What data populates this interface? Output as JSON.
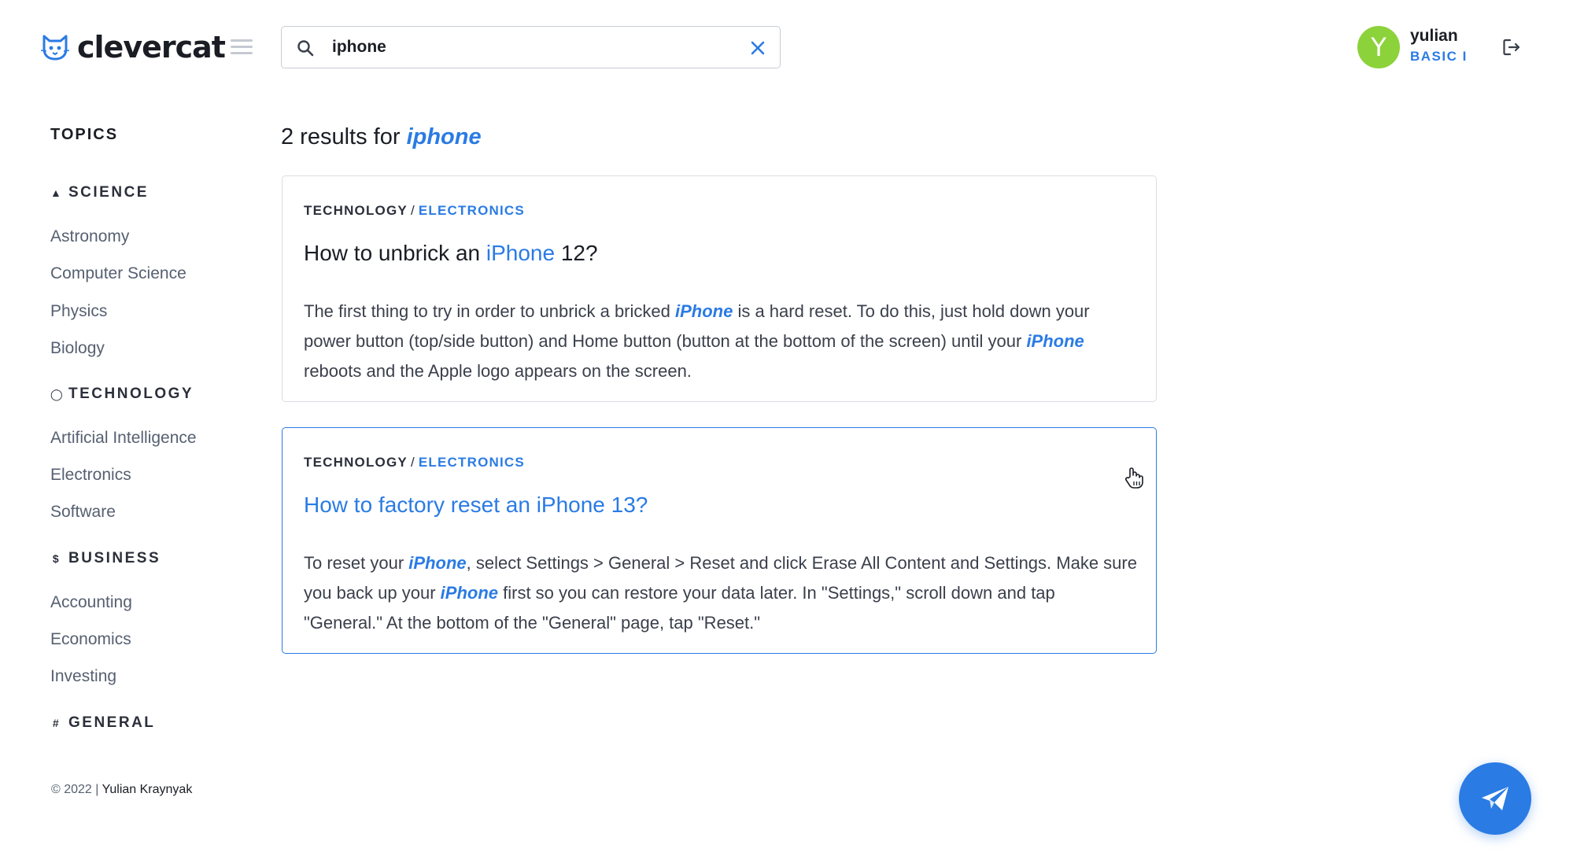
{
  "header": {
    "logo_text": "clevercat",
    "search_value": "iphone",
    "user": {
      "initial": "Y",
      "name": "yulian",
      "plan": "BASIC I"
    }
  },
  "sidebar": {
    "title": "TOPICS",
    "categories": [
      {
        "icon": "flask-icon",
        "label": "SCIENCE",
        "items": [
          "Astronomy",
          "Computer Science",
          "Physics",
          "Biology"
        ]
      },
      {
        "icon": "globe-icon",
        "label": "TECHNOLOGY",
        "items": [
          "Artificial Intelligence",
          "Electronics",
          "Software"
        ]
      },
      {
        "icon": "dollar-icon",
        "label": "BUSINESS",
        "items": [
          "Accounting",
          "Economics",
          "Investing"
        ]
      },
      {
        "icon": "hash-icon",
        "label": "GENERAL",
        "items": []
      }
    ],
    "copyright_prefix": "© 2022 |",
    "copyright_author": "Yulian Kraynyak"
  },
  "results": {
    "count_text": "2 results for",
    "query": "iphone",
    "items": [
      {
        "category": "TECHNOLOGY",
        "subcategory": "ELECTRONICS",
        "title_before": "How to unbrick an",
        "title_highlight": "iPhone",
        "title_after": "12?",
        "body": [
          {
            "t": "The first thing to try in order to unbrick a bricked "
          },
          {
            "t": "iPhone",
            "hl": true
          },
          {
            "t": " is a hard reset. To do this, just hold down your power button (top/side button) and Home button (button at the bottom of the screen) until your "
          },
          {
            "t": "iPhone",
            "hl": true
          },
          {
            "t": " reboots and the Apple logo appears on the screen."
          }
        ]
      },
      {
        "category": "TECHNOLOGY",
        "subcategory": "ELECTRONICS",
        "title_before": "How to factory reset an",
        "title_highlight": "iPhone",
        "title_after": "13?",
        "body": [
          {
            "t": "To reset your "
          },
          {
            "t": "iPhone",
            "hl": true
          },
          {
            "t": ", select Settings > General > Reset and click Erase All Content and Settings. Make sure you back up your "
          },
          {
            "t": "iPhone",
            "hl": true
          },
          {
            "t": " first so you can restore your data later. In \"Settings,\" scroll down and tap \"General.\" At the bottom of the \"General\" page, tap \"Reset.\""
          }
        ]
      }
    ]
  },
  "colors": {
    "accent": "#2a7be4",
    "avatar": "#8cd23b",
    "text": "#1a1d24",
    "muted": "#566071"
  }
}
